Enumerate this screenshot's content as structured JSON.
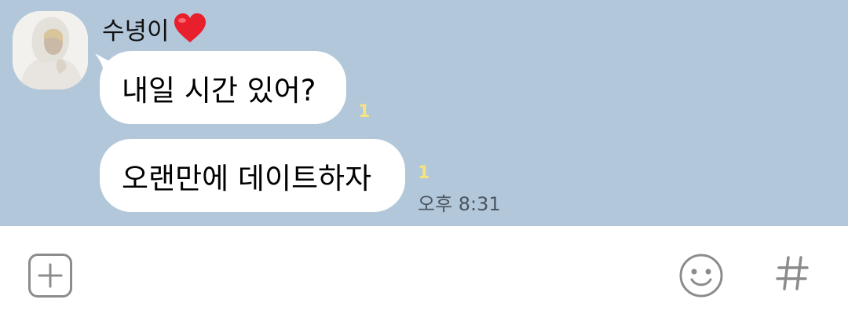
{
  "chat": {
    "sender": {
      "name": "수녕이",
      "avatar_icon": "avatar-photo"
    },
    "messages": [
      {
        "text": "내일 시간 있어?",
        "unread_count": "1"
      },
      {
        "text": "오랜만에 데이트하자",
        "unread_count": "1",
        "time": "오후 8:31"
      }
    ]
  },
  "input_bar": {
    "plus_icon": "plus-icon",
    "emoji_icon": "emoji-icon",
    "hash_icon": "hash-icon"
  },
  "colors": {
    "chat_background": "#b2c7da",
    "bubble": "#ffffff",
    "unread": "#f4e37e",
    "icon_gray": "#8c8c8c"
  }
}
